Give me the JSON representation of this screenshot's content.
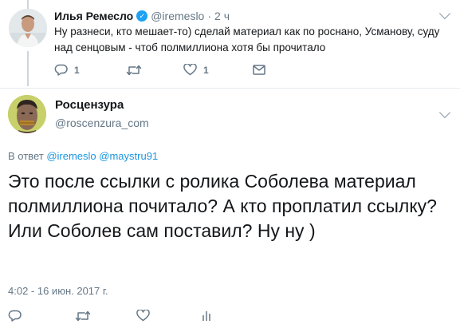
{
  "reply_tweet": {
    "author_name": "Илья Ремесло",
    "verified": true,
    "handle": "@iremeslo",
    "separator": "·",
    "time": "2 ч",
    "text": "Ну разнеси, кто мешает-то) сделай материал как по роснано, Усманову, суду над сенцовым - чтоб полмиллиона хотя бы прочитало",
    "reply_count": "1",
    "like_count": "1",
    "icons": [
      "reply-icon",
      "retweet-icon",
      "like-icon",
      "direct-message-icon"
    ]
  },
  "main_tweet": {
    "author_name": "Росцензура",
    "handle": "@roscenzura_com",
    "in_reply_prefix": "В ответ",
    "in_reply_mention_1": "@iremeslo",
    "in_reply_mention_2": "@maystru91",
    "text": "Это после ссылки с ролика Соболева материал полмиллиона почитало? А кто проплатил ссылку? Или Соболев сам поставил? Ну ну )",
    "timestamp": "4:02 - 16 июн. 2017 г.",
    "icons": [
      "reply-icon",
      "retweet-icon",
      "like-icon",
      "analytics-icon"
    ]
  },
  "colors": {
    "text": "#14171a",
    "secondary": "#657786",
    "link": "#1b95e0",
    "verified": "#1da1f2",
    "divider": "#e6ecf0"
  }
}
